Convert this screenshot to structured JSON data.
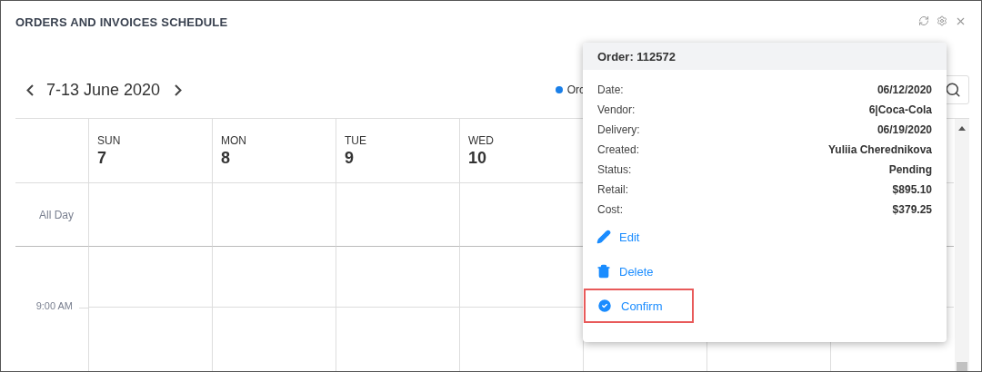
{
  "window": {
    "title": "ORDERS AND INVOICES SCHEDULE"
  },
  "toolbar": {
    "date_range": "7-13 June 2020",
    "legend": [
      {
        "label": "Orc",
        "color": "#1a7fe8"
      }
    ]
  },
  "calendar": {
    "days": [
      {
        "name": "SUN",
        "number": "7"
      },
      {
        "name": "MON",
        "number": "8"
      },
      {
        "name": "TUE",
        "number": "9"
      },
      {
        "name": "WED",
        "number": "10"
      }
    ],
    "all_day_label": "All Day",
    "times": [
      "9:00 AM"
    ]
  },
  "popup": {
    "title": "Order: 112572",
    "fields": [
      {
        "label": "Date:",
        "value": "06/12/2020"
      },
      {
        "label": "Vendor:",
        "value": "6|Coca-Cola"
      },
      {
        "label": "Delivery:",
        "value": "06/19/2020"
      },
      {
        "label": "Created:",
        "value": "Yuliia Cherednikova"
      },
      {
        "label": "Status:",
        "value": "Pending"
      },
      {
        "label": "Retail:",
        "value": "$895.10"
      },
      {
        "label": "Cost:",
        "value": "$379.25"
      }
    ],
    "actions": [
      {
        "kind": "edit",
        "label": "Edit",
        "highlighted": false
      },
      {
        "kind": "delete",
        "label": "Delete",
        "highlighted": false
      },
      {
        "kind": "confirm",
        "label": "Confirm",
        "highlighted": true
      }
    ]
  }
}
